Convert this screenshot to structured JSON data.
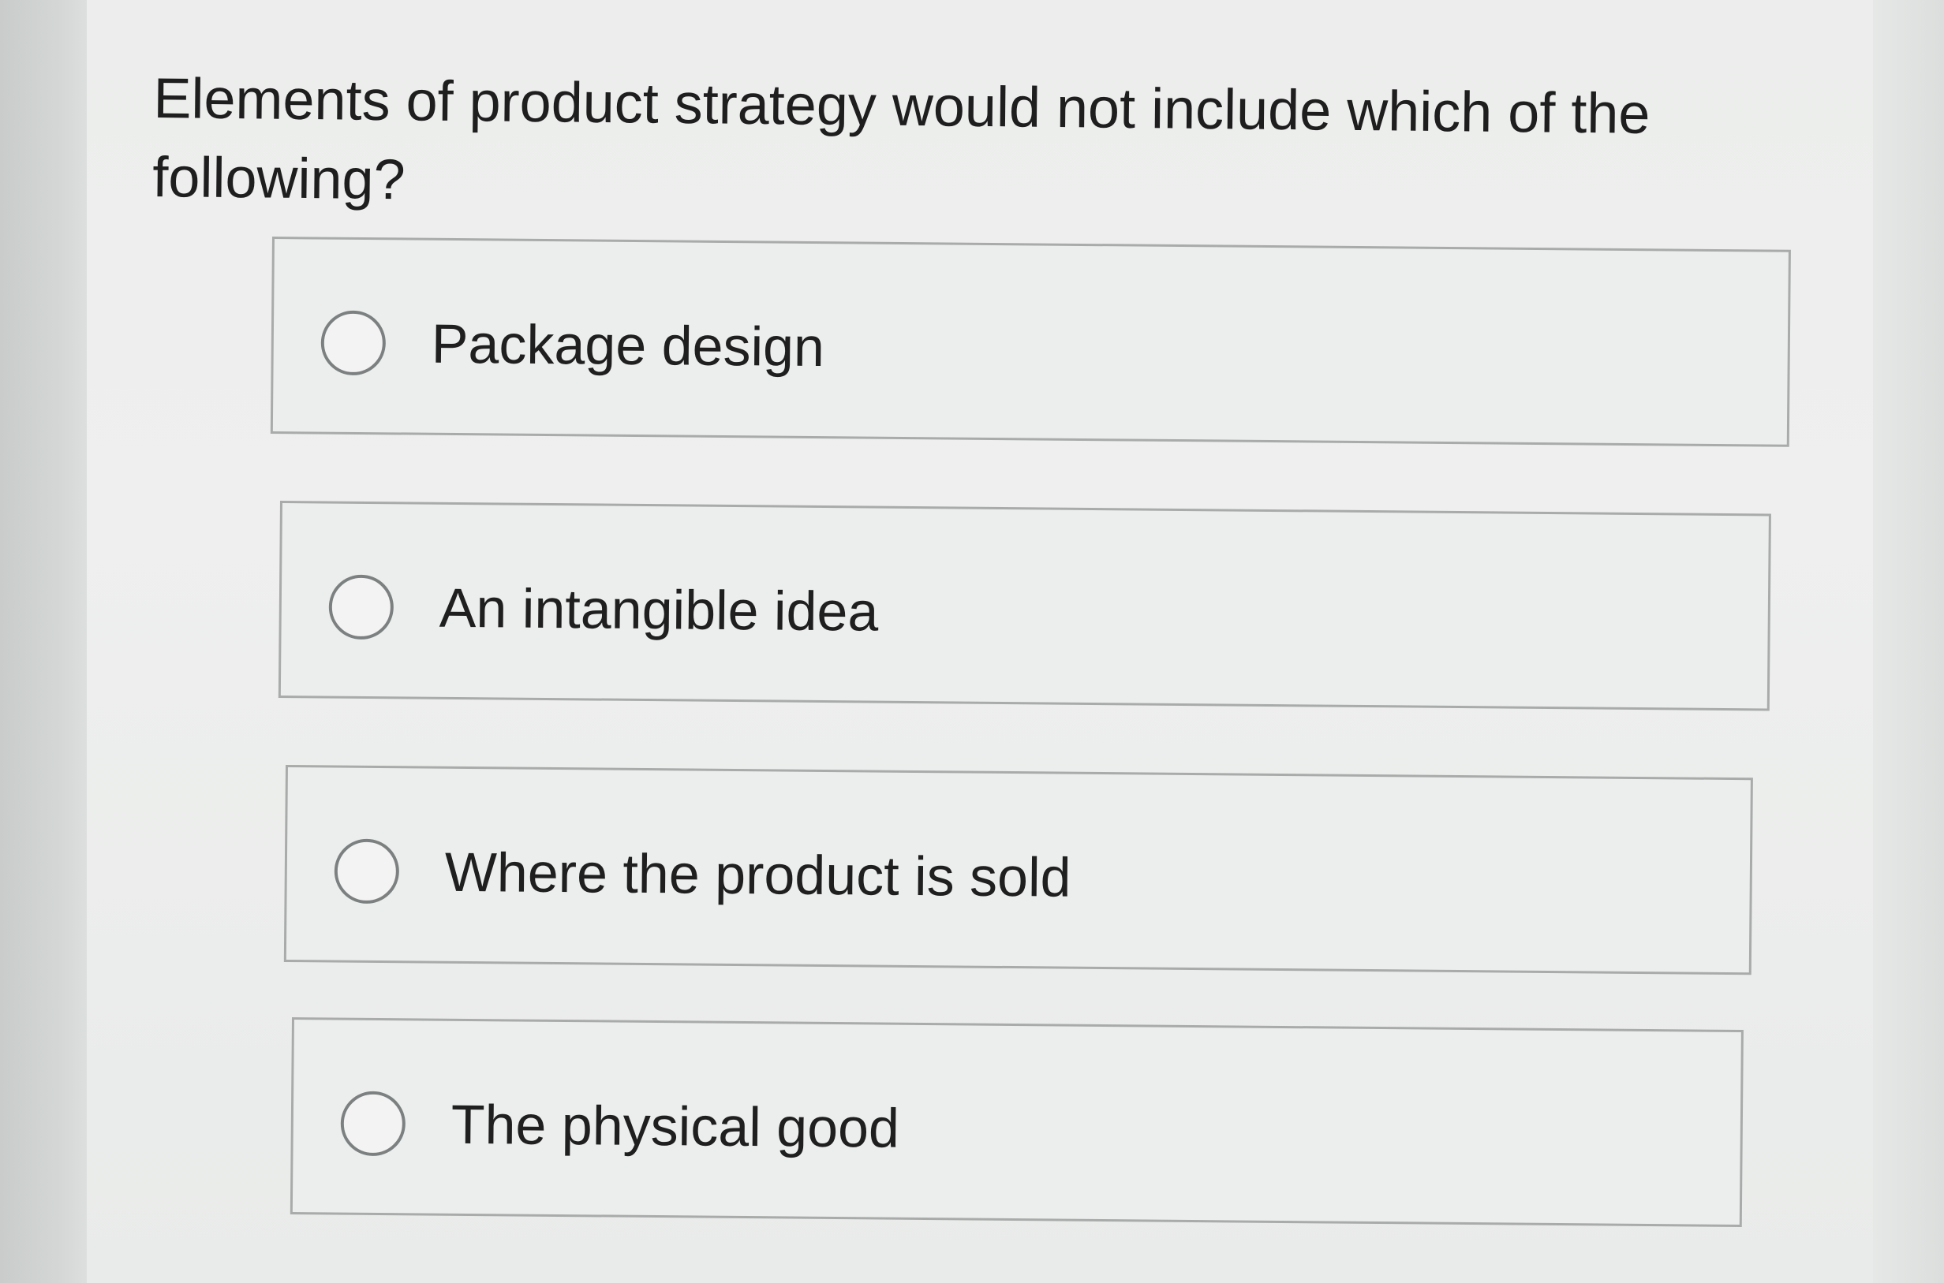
{
  "question": {
    "text": "Elements of product strategy would not include which of the following?"
  },
  "options": [
    {
      "label": "Package design",
      "selected": false
    },
    {
      "label": "An intangible idea",
      "selected": false
    },
    {
      "label": "Where the product is sold",
      "selected": false
    },
    {
      "label": "The physical good",
      "selected": false
    }
  ],
  "colors": {
    "panel_background": "#edeeed",
    "border": "#a8abaa",
    "text": "#1e1e1e",
    "radio_border": "#7c8080"
  },
  "icons": {
    "radio": "radio-unchecked-icon"
  }
}
